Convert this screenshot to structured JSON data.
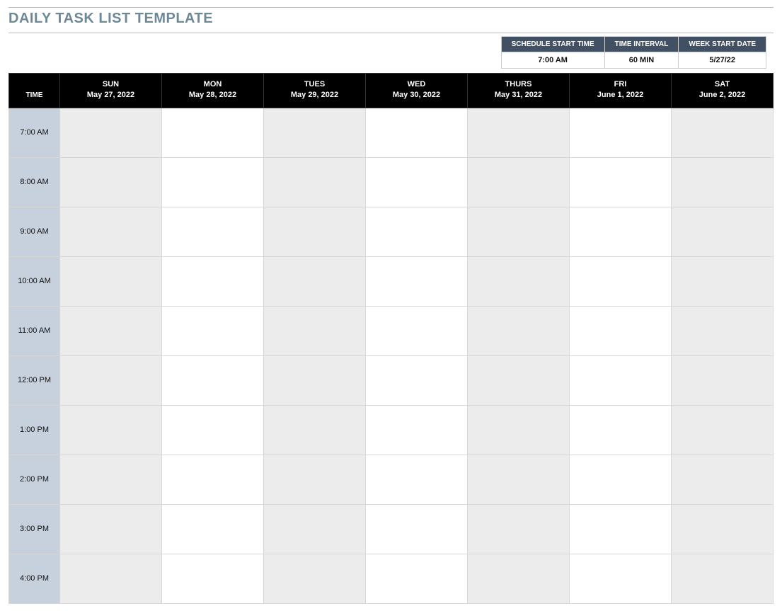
{
  "title": "DAILY TASK LIST TEMPLATE",
  "config": {
    "headers": {
      "start": "SCHEDULE START TIME",
      "interval": "TIME INTERVAL",
      "week": "WEEK START DATE"
    },
    "values": {
      "start": "7:00 AM",
      "interval": "60 MIN",
      "week": "5/27/22"
    }
  },
  "grid": {
    "time_label": "TIME",
    "days": [
      {
        "name": "SUN",
        "date": "May 27, 2022"
      },
      {
        "name": "MON",
        "date": "May 28, 2022"
      },
      {
        "name": "TUES",
        "date": "May 29, 2022"
      },
      {
        "name": "WED",
        "date": "May 30, 2022"
      },
      {
        "name": "THURS",
        "date": "May 31, 2022"
      },
      {
        "name": "FRI",
        "date": "June 1, 2022"
      },
      {
        "name": "SAT",
        "date": "June 2, 2022"
      }
    ],
    "times": [
      "7:00 AM",
      "8:00 AM",
      "9:00 AM",
      "10:00 AM",
      "11:00 AM",
      "12:00 PM",
      "1:00 PM",
      "2:00 PM",
      "3:00 PM",
      "4:00 PM"
    ],
    "shaded_day_indices": [
      0,
      2,
      4,
      6
    ]
  }
}
